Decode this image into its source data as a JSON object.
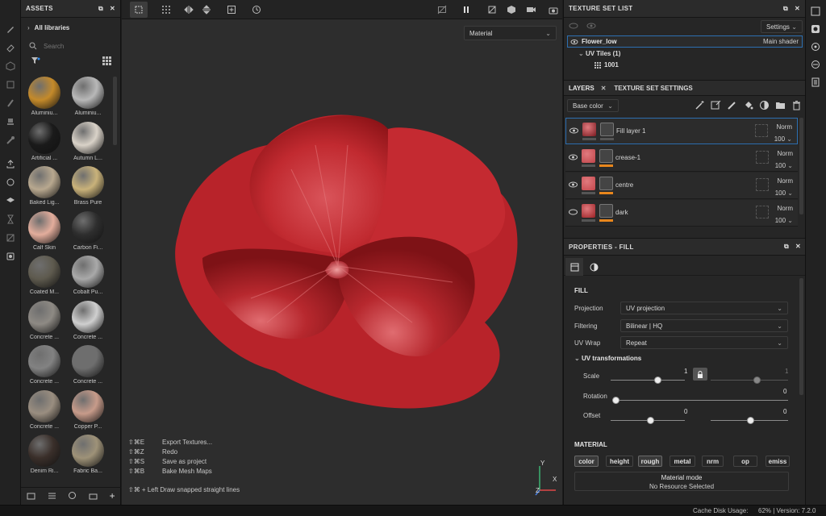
{
  "assets": {
    "title": "ASSETS",
    "breadcrumb": "All libraries",
    "search_placeholder": "Search",
    "items": [
      {
        "label": "Aluminiu...",
        "color": "#c48a2a"
      },
      {
        "label": "Aluminiu...",
        "color": "#b8b8b8"
      },
      {
        "label": "Artificial ...",
        "color": "#1a1a1a"
      },
      {
        "label": "Autumn L...",
        "color": "#d9d2c8"
      },
      {
        "label": "Baked Lig...",
        "color": "#b8a88f"
      },
      {
        "label": "Brass Pure",
        "color": "#c9b27a"
      },
      {
        "label": "Calf Skin",
        "color": "#e3ad9c"
      },
      {
        "label": "Carbon Fi...",
        "color": "#2e2e2e"
      },
      {
        "label": "Coated M...",
        "color": "#5e5a4e"
      },
      {
        "label": "Cobalt Pu...",
        "color": "#a9a9a9"
      },
      {
        "label": "Concrete ...",
        "color": "#8e8a84"
      },
      {
        "label": "Concrete ...",
        "color": "#cfcfcf"
      },
      {
        "label": "Concrete ...",
        "color": "#828282"
      },
      {
        "label": "Concrete ...",
        "color": "#6e6e6e"
      },
      {
        "label": "Concrete ...",
        "color": "#9a8e80"
      },
      {
        "label": "Copper P...",
        "color": "#c79b8a"
      },
      {
        "label": "Denim Ri...",
        "color": "#3a2f2a"
      },
      {
        "label": "Fabric Ba...",
        "color": "#9e9278"
      }
    ]
  },
  "viewport": {
    "mode_dropdown": "Material",
    "shortcuts": [
      {
        "keys": "⇧⌘E",
        "action": "Export Textures..."
      },
      {
        "keys": "⇧⌘Z",
        "action": "Redo"
      },
      {
        "keys": "⇧⌘S",
        "action": "Save as project"
      },
      {
        "keys": "⇧⌘B",
        "action": "Bake Mesh Maps"
      }
    ],
    "hint": "⇧⌘ + Left  Draw snapped straight lines",
    "axis_y": "Y",
    "axis_x": "X",
    "axis_z": "Z"
  },
  "texture_set_list": {
    "title": "TEXTURE SET LIST",
    "settings_label": "Settings",
    "set_name": "Flower_low",
    "shader": "Main shader",
    "uv_tiles": "UV Tiles (1)",
    "tile_id": "1001"
  },
  "layers": {
    "tab_layers": "LAYERS",
    "tab_settings": "TEXTURE SET SETTINGS",
    "channel_dropdown": "Base color",
    "rows": [
      {
        "name": "Fill layer 1",
        "blend": "Norm",
        "opacity": "100"
      },
      {
        "name": "crease-1",
        "blend": "Norm",
        "opacity": "100"
      },
      {
        "name": "centre",
        "blend": "Norm",
        "opacity": "100"
      },
      {
        "name": "dark",
        "blend": "Norm",
        "opacity": "100"
      }
    ]
  },
  "properties": {
    "title": "PROPERTIES - FILL",
    "section_fill": "FILL",
    "projection_label": "Projection",
    "projection_value": "UV projection",
    "filtering_label": "Filtering",
    "filtering_value": "Bilinear | HQ",
    "uvwrap_label": "UV Wrap",
    "uvwrap_value": "Repeat",
    "uv_transform_label": "UV transformations",
    "scale_label": "Scale",
    "scale_value": "1",
    "scale_value2": "1",
    "rotation_label": "Rotation",
    "rotation_value": "0",
    "offset_label": "Offset",
    "offset_value_u": "0",
    "offset_value_v": "0",
    "section_material": "MATERIAL",
    "channels": [
      "color",
      "height",
      "rough",
      "metal",
      "nrm",
      "op",
      "emiss"
    ],
    "material_mode_label": "Material mode",
    "material_mode_value": "No Resource Selected"
  },
  "status": {
    "cache": "Cache Disk Usage:",
    "usage": "62% | Version: 7.2.0"
  }
}
